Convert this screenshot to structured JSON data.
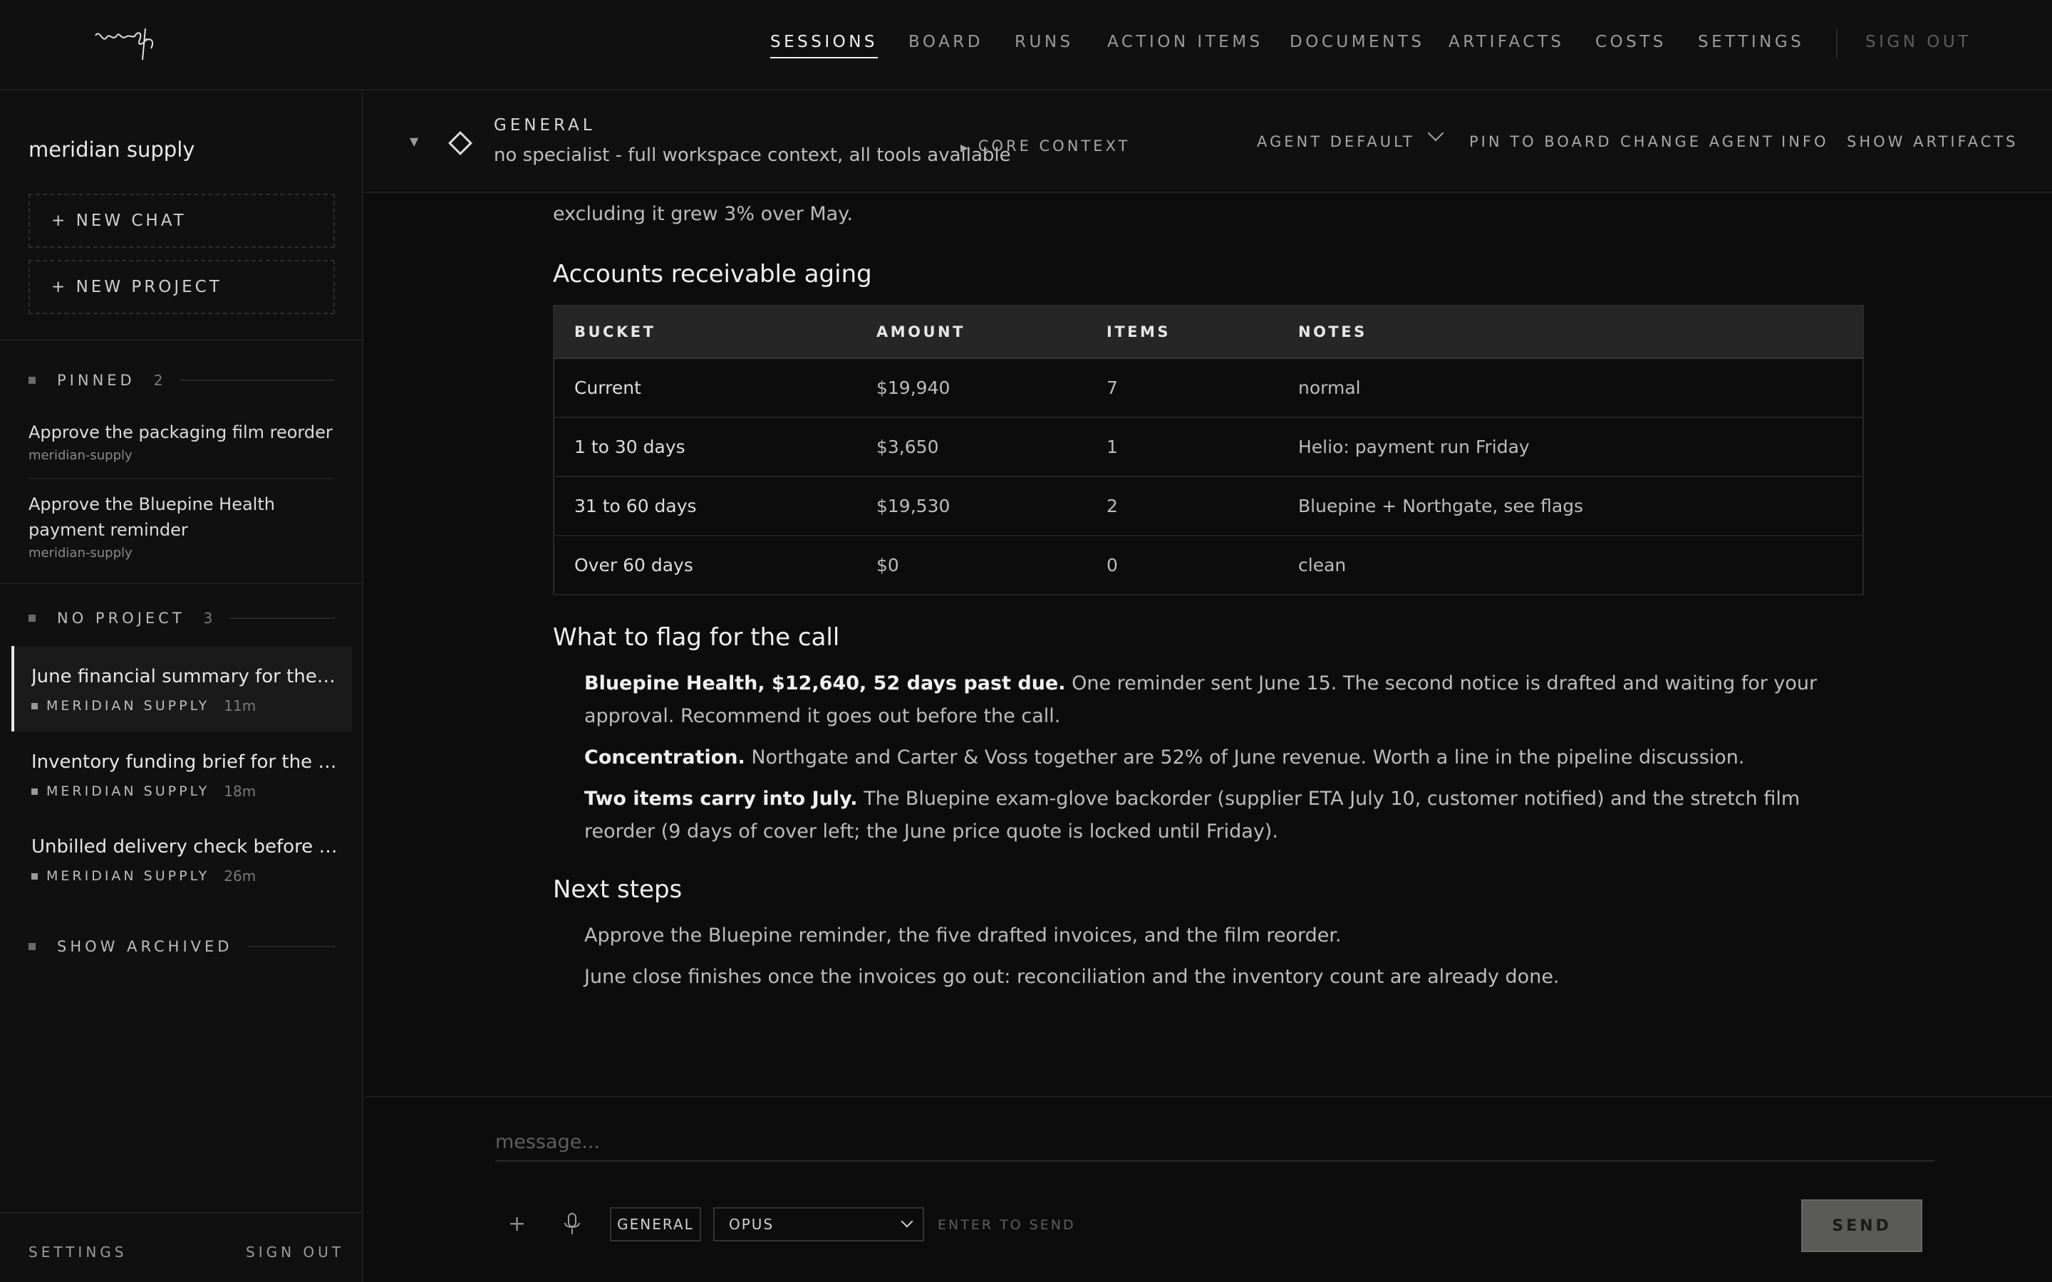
{
  "nav": {
    "items": [
      "Sessions",
      "Board",
      "Runs",
      "Action Items",
      "Documents",
      "Artifacts",
      "Costs",
      "Settings"
    ],
    "active": "Sessions",
    "sign_out": "Sign out"
  },
  "sidebar": {
    "workspace": "meridian supply",
    "new_chat": "+ NEW CHAT",
    "new_project": "+ NEW PROJECT",
    "pinned": {
      "label": "Pinned",
      "count": "2",
      "items": [
        {
          "title": "Approve the packaging film reorder",
          "project": "meridian-supply"
        },
        {
          "title": "Approve the Bluepine Health payment reminder",
          "project": "meridian-supply"
        }
      ]
    },
    "no_project": {
      "label": "No project",
      "count": "3",
      "items": [
        {
          "title": "June financial summary for the leadership call",
          "project": "meridian supply",
          "time": "11m"
        },
        {
          "title": "Inventory funding brief for the bank",
          "project": "meridian supply",
          "time": "18m"
        },
        {
          "title": "Unbilled delivery check before June close",
          "project": "meridian supply",
          "time": "26m"
        }
      ]
    },
    "show_archived": "Show archived",
    "footer": {
      "settings": "Settings",
      "sign_out": "Sign out"
    }
  },
  "session_header": {
    "agent": "General",
    "description": "no specialist - full workspace context, all tools available",
    "core_context": "Core context",
    "agent_default": "Agent default",
    "pin": "Pin to board",
    "change_agent": "Change agent",
    "info": "Info",
    "show_artifacts": "Show artifacts"
  },
  "content": {
    "intro_tail": "excluding it grew 3% over May.",
    "ar_heading": "Accounts receivable aging",
    "table": {
      "columns": [
        "Bucket",
        "Amount",
        "Items",
        "Notes"
      ],
      "rows": [
        [
          "Current",
          "$19,940",
          "7",
          "normal"
        ],
        [
          "1 to 30 days",
          "$3,650",
          "1",
          "Helio: payment run Friday"
        ],
        [
          "31 to 60 days",
          "$19,530",
          "2",
          "Bluepine + Northgate, see flags"
        ],
        [
          "Over 60 days",
          "$0",
          "0",
          "clean"
        ]
      ]
    },
    "flag_heading": "What to flag for the call",
    "flags": [
      {
        "bold": "Bluepine Health, $12,640, 52 days past due.",
        "text": " One reminder sent June 15. The second notice is drafted and waiting for your approval. Recommend it goes out before the call."
      },
      {
        "bold": "Concentration.",
        "text": " Northgate and Carter & Voss together are 52% of June revenue. Worth a line in the pipeline discussion."
      },
      {
        "bold": "Two items carry into July.",
        "text": " The Bluepine exam-glove backorder (supplier ETA July 10, customer notified) and the stretch film reorder (9 days of cover left; the June price quote is locked until Friday)."
      }
    ],
    "next_heading": "Next steps",
    "next_steps": [
      "Approve the Bluepine reminder, the five drafted invoices, and the film reorder.",
      "June close finishes once the invoices go out: reconciliation and the inventory count are already done."
    ]
  },
  "composer": {
    "placeholder": "message...",
    "mode": "General",
    "model": "Opus",
    "hint": "Enter to send",
    "send": "Send"
  },
  "icons": [
    "logo",
    "caret-down-icon",
    "diamond-icon",
    "triangle-right-icon",
    "chevron-down-icon",
    "plus-icon",
    "mic-icon"
  ]
}
